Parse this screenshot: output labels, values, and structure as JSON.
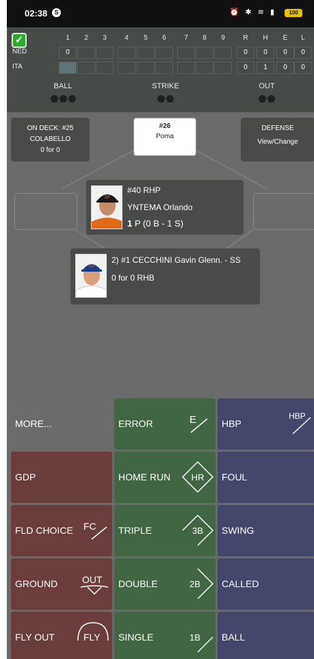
{
  "status_bar": {
    "time": "02:38",
    "notification": "S",
    "icons": "⏰ ✱ ≋ ▮",
    "battery": "100"
  },
  "scoreboard": {
    "innings": [
      "1",
      "2",
      "3",
      "4",
      "5",
      "6",
      "7",
      "8",
      "9"
    ],
    "totals_headers": [
      "R",
      "H",
      "E",
      "L"
    ],
    "teams": [
      {
        "name": "NED",
        "innings": [
          "0",
          "",
          "",
          "",
          "",
          "",
          "",
          "",
          ""
        ],
        "totals": [
          "0",
          "0",
          "0",
          "0"
        ]
      },
      {
        "name": "ITA",
        "innings": [
          "",
          "",
          "",
          "",
          "",
          "",
          "",
          "",
          ""
        ],
        "totals": [
          "0",
          "1",
          "0",
          "0"
        ]
      }
    ],
    "ball_label": "BALL",
    "strike_label": "STRIKE",
    "out_label": "OUT",
    "balls": 3,
    "strikes": 2,
    "outs": 2
  },
  "on_deck": {
    "line1": "ON DECK: #25",
    "line2": "COLABELLO",
    "line3": "0 for 0"
  },
  "defense": {
    "line1": "DEFENSE",
    "line2": "View/Change"
  },
  "runner_second": {
    "number": "#26",
    "name": "Poma"
  },
  "pitcher": {
    "line1": "#40 RHP",
    "line2": "YNTEMA Orlando",
    "pitch_count": "1",
    "pitch_detail": " P (0 B - 1 S)"
  },
  "batter": {
    "line1": "2) #1 CECCHINI Gavin Glenn. - SS",
    "line2": "0 for 0 RHB"
  },
  "actions": {
    "more": "MORE...",
    "gdp": "GDP",
    "fld_choice": "FLD CHOICE",
    "ground": "GROUND",
    "fly_out": "FLY OUT",
    "error": "ERROR",
    "home_run": "HOME RUN",
    "triple": "TRIPLE",
    "double": "DOUBLE",
    "single": "SINGLE",
    "hbp": "HBP",
    "foul": "FOUL",
    "swing": "SWING",
    "called": "CALLED",
    "ball": "BALL",
    "icons": {
      "error": "E",
      "hbp": "HBP",
      "fc": "FC",
      "out": "OUT",
      "fly": "FLY",
      "hr": "HR",
      "three_b": "3B",
      "two_b": "2B",
      "one_b": "1B"
    }
  },
  "colors": {
    "outs_red": "#6b3d3d",
    "hits_green": "#426644",
    "pitches_blue": "#45476a",
    "neutral_gray": "#6b6b6b"
  }
}
